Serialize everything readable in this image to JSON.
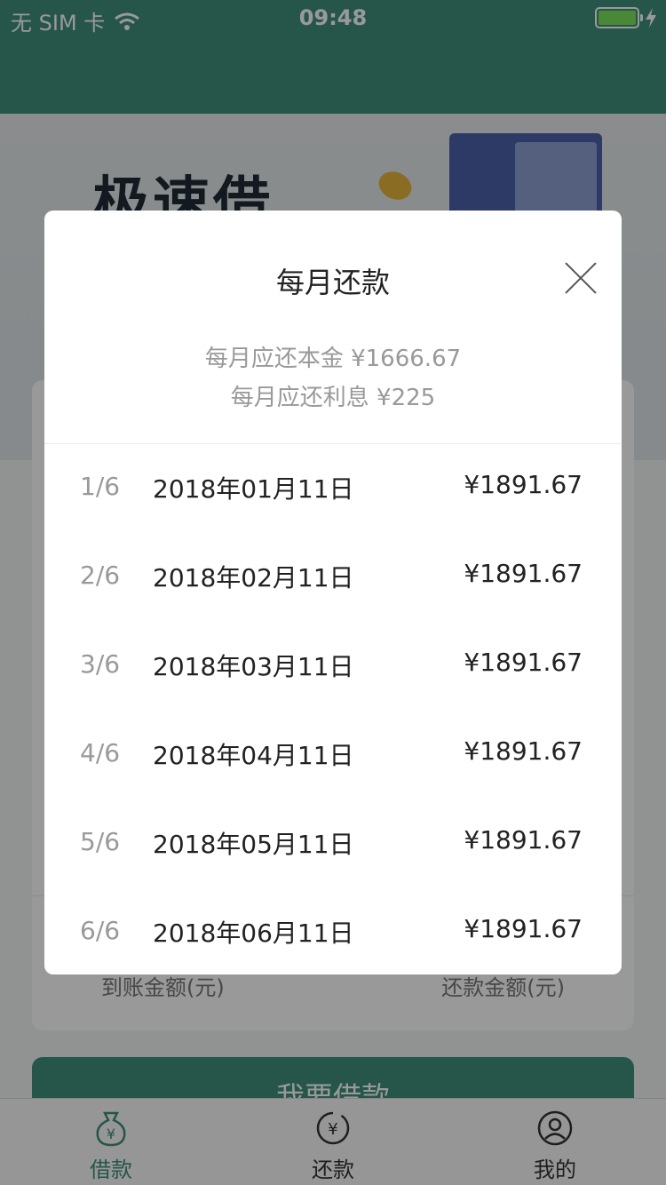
{
  "status_bar": {
    "carrier": "无 SIM 卡",
    "time": "09:48",
    "wifi_icon": "wifi-icon",
    "battery_icon": "battery-icon",
    "charging_icon": "bolt-icon"
  },
  "banner": {
    "title": "极速借"
  },
  "card": {
    "left_label": "到账金额(元)",
    "right_label": "还款金额(元)"
  },
  "cta": {
    "label": "我要借款"
  },
  "tabbar": {
    "items": [
      {
        "label": "借款",
        "icon": "money-bag-icon",
        "active": true
      },
      {
        "label": "还款",
        "icon": "repay-cycle-icon",
        "active": false
      },
      {
        "label": "我的",
        "icon": "user-icon",
        "active": false
      }
    ]
  },
  "modal": {
    "title": "每月还款",
    "principal_line": "每月应还本金 ¥1666.67",
    "interest_line": "每月应还利息 ¥225",
    "rows": [
      {
        "index": "1/6",
        "date": "2018年01月11日",
        "amount": "¥1891.67"
      },
      {
        "index": "2/6",
        "date": "2018年02月11日",
        "amount": "¥1891.67"
      },
      {
        "index": "3/6",
        "date": "2018年03月11日",
        "amount": "¥1891.67"
      },
      {
        "index": "4/6",
        "date": "2018年04月11日",
        "amount": "¥1891.67"
      },
      {
        "index": "5/6",
        "date": "2018年05月11日",
        "amount": "¥1891.67"
      },
      {
        "index": "6/6",
        "date": "2018年06月11日",
        "amount": "¥1891.67"
      }
    ]
  },
  "colors": {
    "brand": "#3f8f7a",
    "battery": "#7ce25a"
  }
}
